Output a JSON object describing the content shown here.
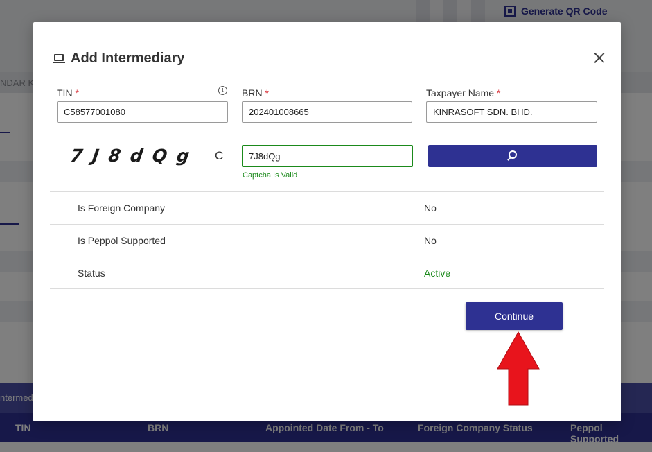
{
  "background": {
    "qr_label": "Generate QR Code",
    "band_text": "NDAR K",
    "table_caption": "ntermed",
    "table_headers": [
      "TIN",
      "BRN",
      "Appointed Date From - To",
      "Foreign Company Status",
      "Peppol Supported"
    ]
  },
  "modal": {
    "title": "Add Intermediary",
    "tin_label": "TIN",
    "brn_label": "BRN",
    "taxpayer_label": "Taxpayer Name",
    "required_mark": "*",
    "info_glyph": "i",
    "tin_value": "C58577001080",
    "brn_value": "202401008665",
    "taxpayer_value": "KINRASOFT SDN. BHD.",
    "captcha_text": "7J8dQg",
    "captcha_refresh": "C",
    "captcha_input": "7J8dQg",
    "captcha_status": "Captcha Is Valid",
    "details": [
      {
        "label": "Is Foreign Company",
        "value": "No"
      },
      {
        "label": "Is Peppol Supported",
        "value": "No"
      },
      {
        "label": "Status",
        "value": "Active"
      }
    ],
    "continue_label": "Continue"
  },
  "colors": {
    "brand": "#2e3192",
    "valid": "#1b8a1b",
    "required": "#d9363e",
    "arrow": "#e8141c"
  }
}
